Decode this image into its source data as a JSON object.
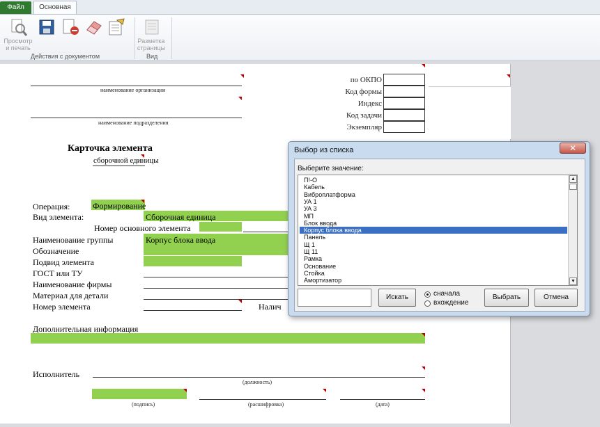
{
  "ribbon": {
    "tabs": [
      "Файл",
      "Основная"
    ],
    "buttons": {
      "preview_label": "Просмотр\nи печать",
      "page_layout_label": "Разметка\nстраницы"
    },
    "groups": [
      "Действия с документом",
      "Вид"
    ]
  },
  "form": {
    "okpo_label": "по ОКПО",
    "form_code_label": "Код формы",
    "index_label": "Индекс",
    "task_code_label": "Код задачи",
    "copy_label": "Экземпляр",
    "org_caption": "наименование организации",
    "dept_caption": "наименование подразделения",
    "title": "Карточка элемента",
    "subtitle": "сборочной единицы",
    "operation_label": "Операция:",
    "operation_value": "Формирование",
    "element_type_label": "Вид элемента:",
    "element_type_value": "Сборочная единица",
    "main_element_number_label": "Номер основного элемента",
    "group_name_label": "Наименование группы",
    "group_name_value": "Корпус блока ввода",
    "designation_label": "Обозначение",
    "subtype_label": "Подвид элемента",
    "gost_label": "ГОСТ или ТУ",
    "company_label": "Наименование фирмы",
    "material_label": "Материал для детали",
    "element_number_label": "Номер элемента",
    "presence_label": "Налич",
    "additional_info_label": "Дополнительная информация",
    "executor_label": "Исполнитель",
    "position_caption": "(должность)",
    "signature_caption": "(подпись)",
    "decoding_caption": "(расшифровка)",
    "date_caption": "(дата)"
  },
  "dialog": {
    "title": "Выбор из списка",
    "close_label": "✕",
    "prompt": "Выберите значение:",
    "items": [
      "П!-О",
      "Кабель",
      "Виброплатформа",
      "УА  1",
      "УА  3",
      "МП",
      "Блок ввода",
      "Корпус блока ввода",
      "Панель",
      "Щ  1",
      "Щ  11",
      "Рамка",
      "Основание",
      "Стойка",
      "Амортизатор"
    ],
    "selected_index": 7,
    "search_value": "",
    "search_button": "Искать",
    "radio_start": "сначала",
    "radio_contains": "вхождение",
    "radio_selected": "start",
    "choose_button": "Выбрать",
    "cancel_button": "Отмена"
  },
  "colors": {
    "green_fill": "#92d050",
    "selection": "#3a6fc4",
    "file_tab": "#2f7a2f",
    "marker": "#c00000"
  }
}
